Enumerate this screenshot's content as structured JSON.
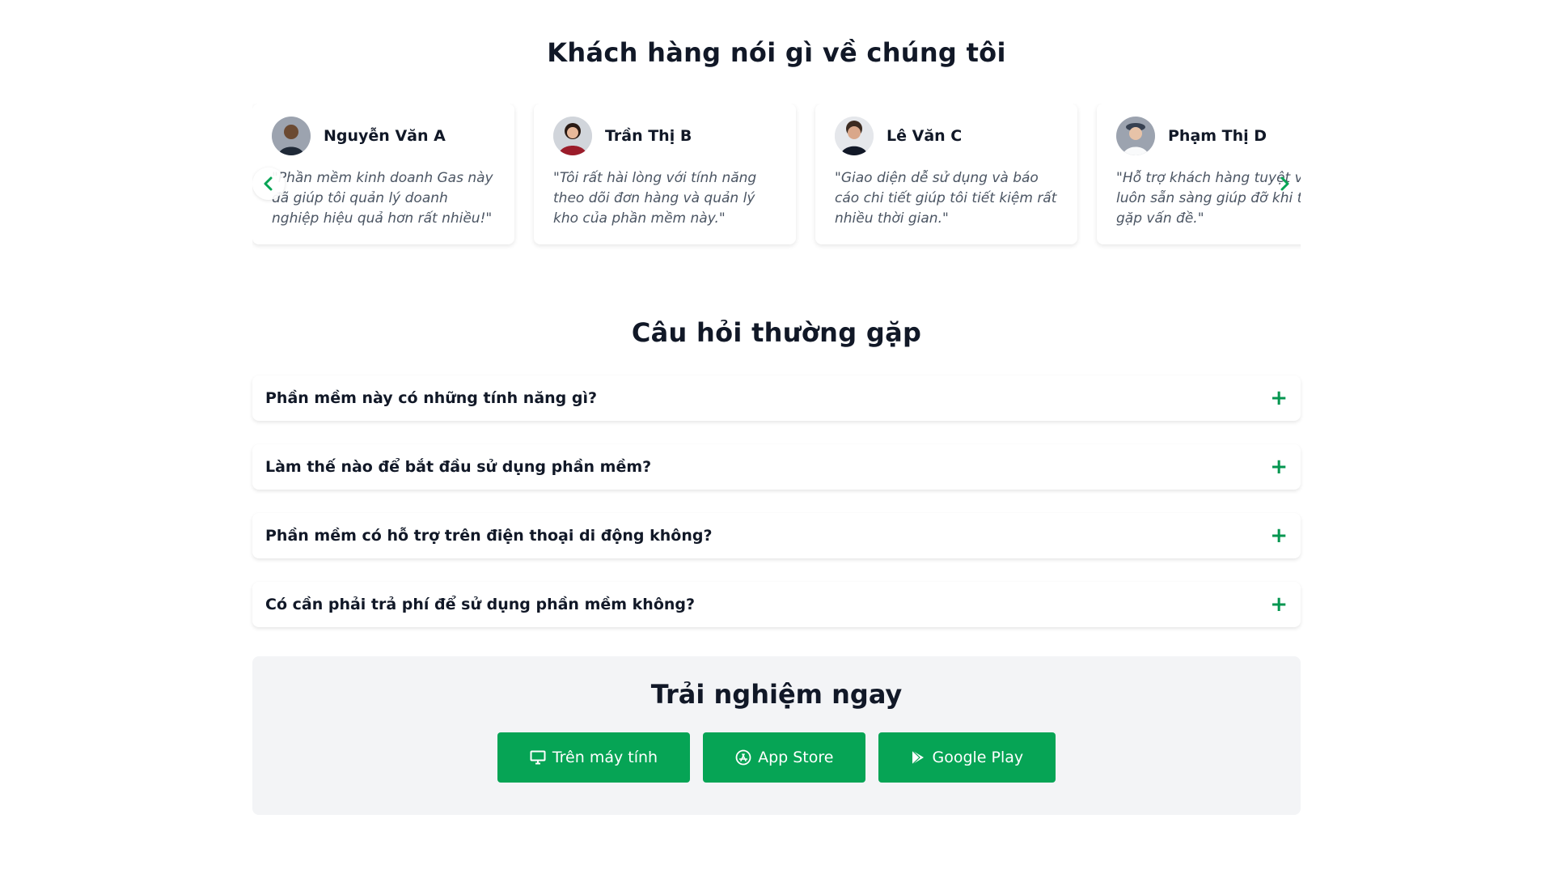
{
  "testimonials": {
    "title": "Khách hàng nói gì về chúng tôi",
    "items": [
      {
        "name": "Nguyễn Văn A",
        "quote": "\"Phần mềm kinh doanh Gas này đã giúp tôi quản lý doanh nghiệp hiệu quả hơn rất nhiều!\""
      },
      {
        "name": "Trần Thị B",
        "quote": "\"Tôi rất hài lòng với tính năng theo dõi đơn hàng và quản lý kho của phần mềm này.\""
      },
      {
        "name": "Lê Văn C",
        "quote": "\"Giao diện dễ sử dụng và báo cáo chi tiết giúp tôi tiết kiệm rất nhiều thời gian.\""
      },
      {
        "name": "Phạm Thị D",
        "quote": "\"Hỗ trợ khách hàng tuyệt vời, luôn sẵn sàng giúp đỡ khi tôi gặp vấn đề.\""
      }
    ],
    "prev_icon": "chevron-left-icon",
    "next_icon": "chevron-right-icon"
  },
  "faq": {
    "title": "Câu hỏi thường gặp",
    "items": [
      {
        "question": "Phần mềm này có những tính năng gì?",
        "icon": "+"
      },
      {
        "question": "Làm thế nào để bắt đầu sử dụng phần mềm?",
        "icon": "+"
      },
      {
        "question": "Phần mềm có hỗ trợ trên điện thoại di động không?",
        "icon": "+"
      },
      {
        "question": "Có cần phải trả phí để sử dụng phần mềm không?",
        "icon": "+"
      }
    ]
  },
  "cta": {
    "title": "Trải nghiệm ngay",
    "buttons": [
      {
        "label": "Trên máy tính",
        "icon": "desktop-icon"
      },
      {
        "label": "App Store",
        "icon": "app-store-icon"
      },
      {
        "label": "Google Play",
        "icon": "google-play-icon"
      }
    ]
  },
  "colors": {
    "accent": "#06a455",
    "text": "#111827",
    "muted": "#4b5563",
    "cta_bg": "#f3f4f6"
  }
}
